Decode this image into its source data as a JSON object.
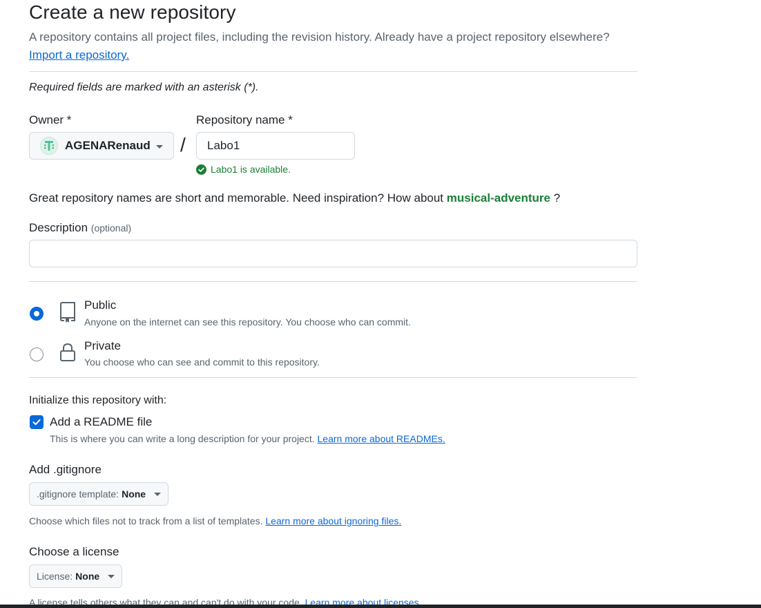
{
  "header": {
    "title": "Create a new repository",
    "subtitle": "A repository contains all project files, including the revision history. Already have a project repository elsewhere?",
    "import_link": "Import a repository.",
    "required_note": "Required fields are marked with an asterisk (*)."
  },
  "owner": {
    "label": "Owner *",
    "name": "AGENARenaud",
    "icon": "avatar-icon"
  },
  "separator": "/",
  "repository": {
    "label": "Repository name *",
    "value": "Labo1",
    "availability": "Labo1 is available."
  },
  "inspiration": {
    "text": "Great repository names are short and memorable. Need inspiration? How about",
    "suggestion": "musical-adventure",
    "suffix": "?"
  },
  "description": {
    "label": "Description",
    "optional": "(optional)",
    "value": ""
  },
  "visibility": {
    "selected": "public",
    "options": [
      {
        "title": "Public",
        "desc": "Anyone on the internet can see this repository. You choose who can commit.",
        "icon": "repo-icon"
      },
      {
        "title": "Private",
        "desc": "You choose who can see and commit to this repository.",
        "icon": "lock-icon"
      }
    ]
  },
  "initialize": {
    "label": "Initialize this repository with:",
    "readme_checked": true,
    "readme_title": "Add a README file",
    "readme_desc": "This is where you can write a long description for your project.",
    "readme_link": "Learn more about READMEs."
  },
  "gitignore": {
    "label": "Add .gitignore",
    "select_prefix": ".gitignore template:",
    "select_value": "None",
    "help": "Choose which files not to track from a list of templates.",
    "help_link": "Learn more about ignoring files."
  },
  "license": {
    "label": "Choose a license",
    "select_prefix": "License:",
    "select_value": "None",
    "help": "A license tells others what they can and can't do with your code.",
    "help_link": "Learn more about licenses."
  },
  "colors": {
    "link": "#0969da",
    "success": "#1a7f37",
    "text": "#1f2328",
    "muted": "#59636e",
    "border": "#d1d9e0"
  }
}
